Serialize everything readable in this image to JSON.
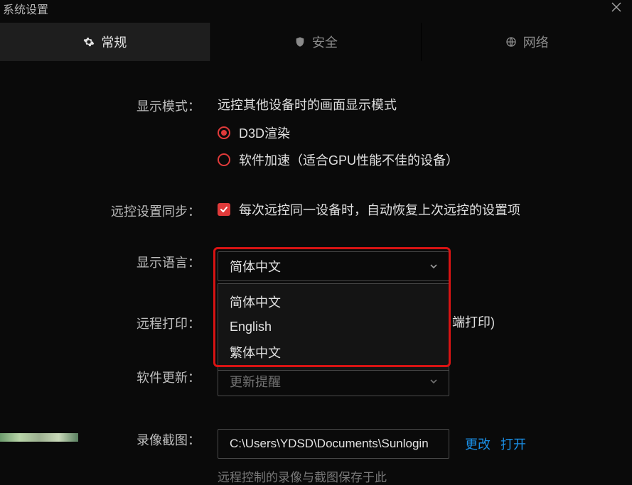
{
  "window": {
    "title": "系统设置"
  },
  "tabs": {
    "general": "常规",
    "security": "安全",
    "network": "网络"
  },
  "labels": {
    "display_mode": "显示模式：",
    "sync": "远控设置同步：",
    "language": "显示语言：",
    "remote_print": "远程打印：",
    "software_update": "软件更新：",
    "recording": "录像截图："
  },
  "display_mode": {
    "desc": "远控其他设备时的画面显示模式",
    "opt1": "D3D渲染",
    "opt2": "软件加速（适合GPU性能不佳的设备）"
  },
  "sync": {
    "text": "每次远控同一设备时，自动恢复上次远控的设置项"
  },
  "language": {
    "selected": "简体中文",
    "options": [
      "简体中文",
      "English",
      "繁体中文"
    ]
  },
  "remote_print": {
    "tail": "端打印)"
  },
  "software_update": {
    "selected_peek": "更新提醒"
  },
  "recording": {
    "path": "C:\\Users\\YDSD\\Documents\\Sunlogin",
    "change": "更改",
    "open": "打开",
    "hint": "远程控制的录像与截图保存于此"
  }
}
